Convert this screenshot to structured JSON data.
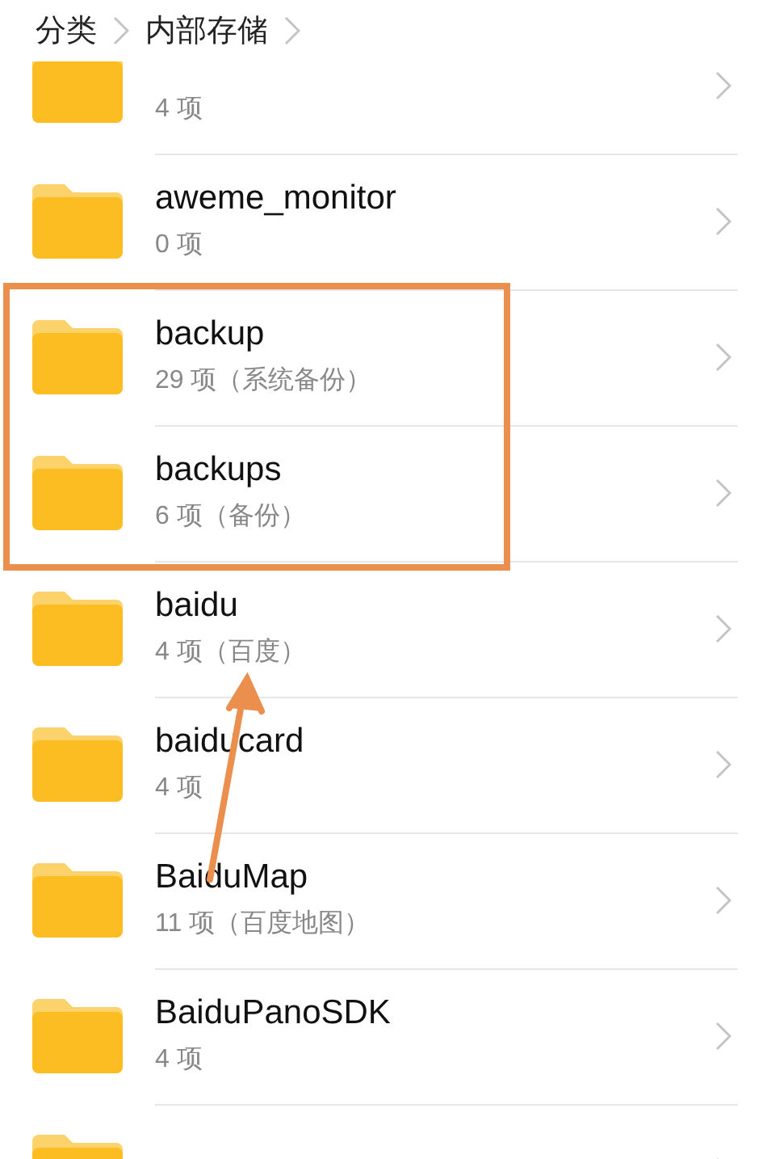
{
  "breadcrumbs": [
    {
      "label": "分类"
    },
    {
      "label": "内部存储"
    }
  ],
  "folders": [
    {
      "info": "4 项",
      "highlighted": false
    },
    {
      "name": "aweme_monitor",
      "info": "0 项",
      "highlighted": false
    },
    {
      "name": "backup",
      "info": "29 项（系统备份）",
      "highlighted": true
    },
    {
      "name": "backups",
      "info": "6 项（备份）",
      "highlighted": true
    },
    {
      "name": "baidu",
      "info": "4 项（百度）",
      "highlighted": false
    },
    {
      "name": "baiducard",
      "info": "4 项",
      "highlighted": false
    },
    {
      "name": "BaiduMap",
      "info": "11 项（百度地图）",
      "highlighted": false
    },
    {
      "name": "BaiduPanoSDK",
      "info": "4 项",
      "highlighted": false
    },
    {
      "highlighted": false
    }
  ]
}
